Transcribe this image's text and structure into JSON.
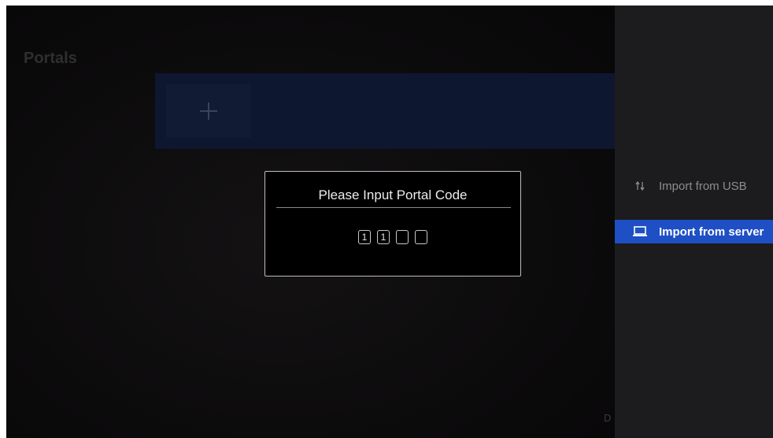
{
  "main": {
    "section_title": "Portals",
    "add_portal_icon": "plus-icon",
    "partial_letter": "D"
  },
  "dialog": {
    "title": "Please Input Portal Code",
    "code_digits": [
      "1",
      "1",
      "",
      ""
    ]
  },
  "side_menu": {
    "items": [
      {
        "label": "Import from USB",
        "icon": "transfer-arrows-icon",
        "selected": false
      },
      {
        "label": "Import from server",
        "icon": "laptop-icon",
        "selected": true
      }
    ]
  },
  "colors": {
    "selected_accent": "#1f4fc4",
    "portal_strip": "#0e1730"
  }
}
